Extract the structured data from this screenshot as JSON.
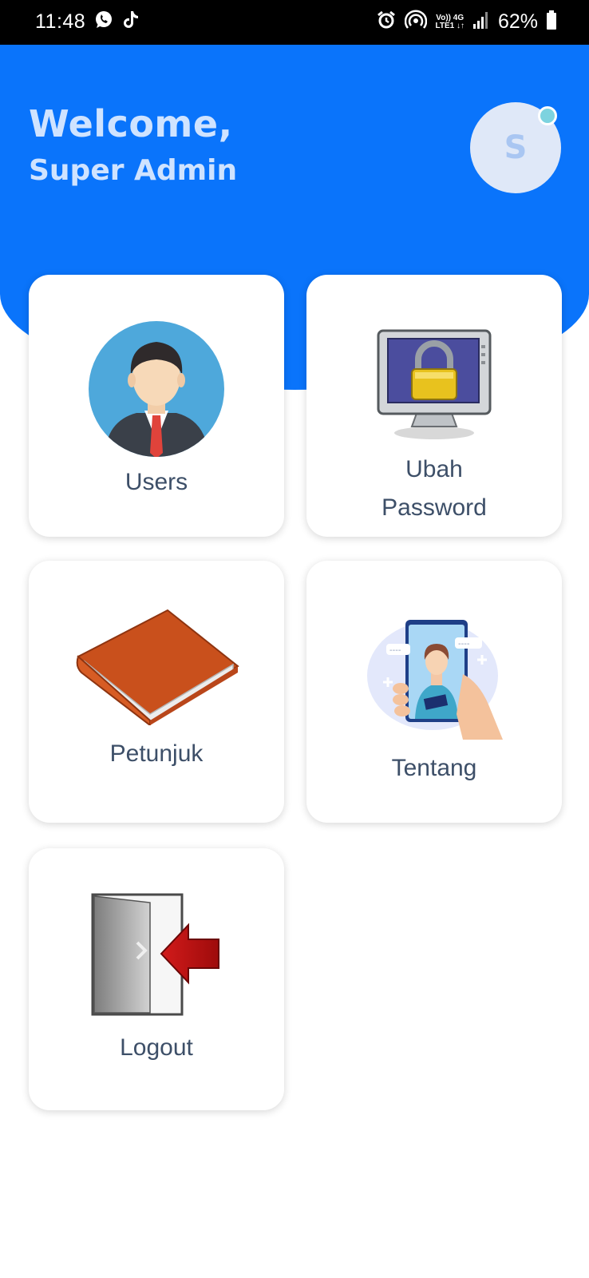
{
  "status_bar": {
    "time": "11:48",
    "network_line1": "Vo)) 4G",
    "network_line2": "LTE1 ↓↑",
    "battery": "62%",
    "icons": [
      "whatsapp-icon",
      "tiktok-icon",
      "alarm-icon",
      "hotspot-icon",
      "signal-icon",
      "battery-icon"
    ]
  },
  "header": {
    "welcome": "Welcome,",
    "user_name": "Super Admin",
    "avatar_initial": "S",
    "colors": {
      "background": "#0a74fb",
      "text": "#cfe3ff",
      "avatar_bg": "#dfe8f8",
      "online_dot": "#7dd3df"
    }
  },
  "menu": {
    "users": {
      "label": "Users",
      "icon": "user-avatar-icon"
    },
    "ubah_password": {
      "label_line1": "Ubah",
      "label_line2": "Password",
      "icon": "password-lock-icon"
    },
    "petunjuk": {
      "label": "Petunjuk",
      "icon": "book-icon"
    },
    "tentang": {
      "label": "Tentang",
      "icon": "about-icon"
    },
    "logout": {
      "label": "Logout",
      "icon": "logout-door-icon"
    }
  }
}
